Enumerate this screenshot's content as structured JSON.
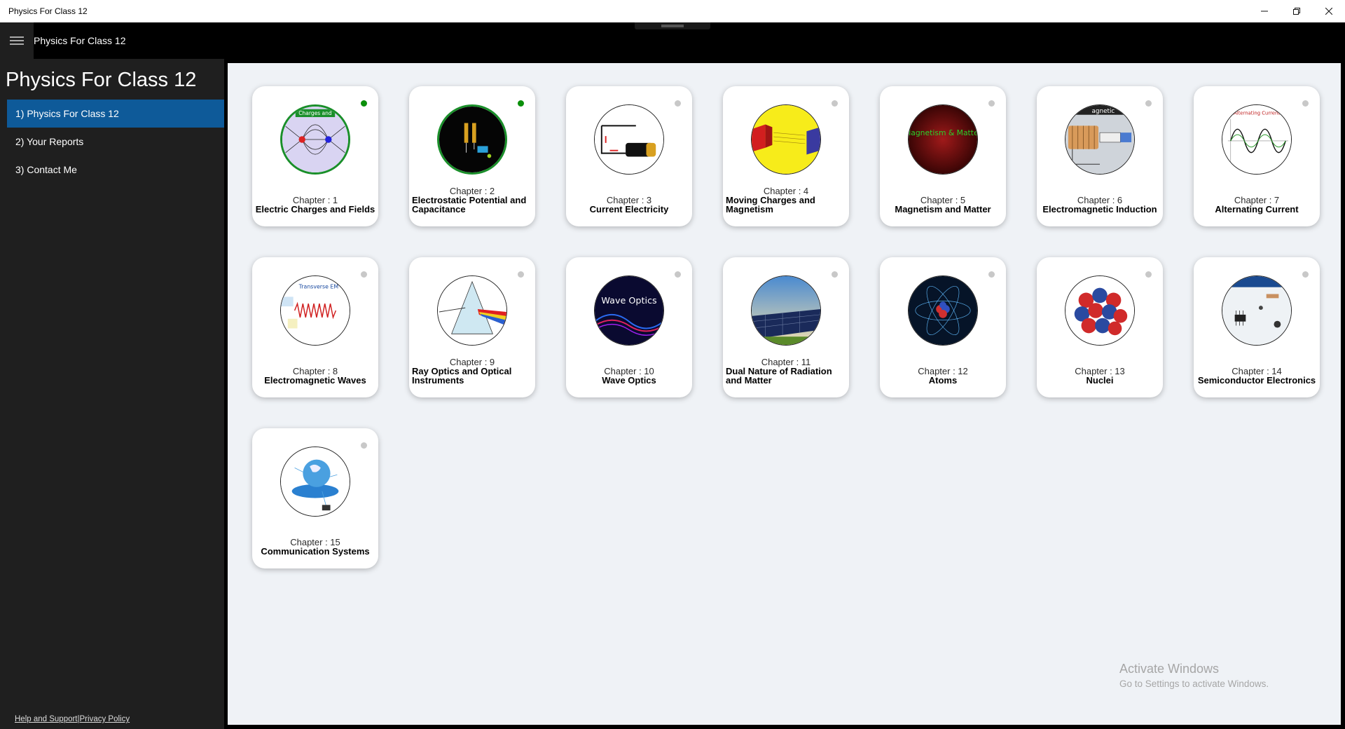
{
  "window": {
    "title": "Physics For Class 12",
    "minimize": "—",
    "restore": "❐",
    "close": "✕"
  },
  "appbar": {
    "title": "Physics For Class 12",
    "menu_icon": "hamburger-icon"
  },
  "sidebar": {
    "heading": "Physics For Class 12",
    "items": [
      {
        "label": "1) Physics For Class 12",
        "active": true
      },
      {
        "label": "2) Your Reports",
        "active": false
      },
      {
        "label": "3) Contact Me",
        "active": false
      }
    ],
    "footer": {
      "help": "Help and Support",
      "separator": "|",
      "privacy": "Privacy Policy"
    }
  },
  "colors": {
    "accent": "#0e5a99",
    "done_dot": "#0a8f0a",
    "pending_dot": "#c8c8c8"
  },
  "chapters": [
    {
      "chapter": "Chapter :  1",
      "name": "Electric Charges and Fields",
      "completed": true
    },
    {
      "chapter": "Chapter :  2",
      "name": "Electrostatic Potential and Capacitance",
      "completed": true
    },
    {
      "chapter": "Chapter :  3",
      "name": "Current Electricity",
      "completed": false
    },
    {
      "chapter": "Chapter :  4",
      "name": "Moving Charges and Magnetism",
      "completed": false
    },
    {
      "chapter": "Chapter :  5",
      "name": "Magnetism and Matter",
      "completed": false
    },
    {
      "chapter": "Chapter :  6",
      "name": "Electromagnetic Induction",
      "completed": false
    },
    {
      "chapter": "Chapter :  7",
      "name": "Alternating Current",
      "completed": false
    },
    {
      "chapter": "Chapter :  8",
      "name": "Electromagnetic Waves",
      "completed": false
    },
    {
      "chapter": "Chapter :  9",
      "name": "Ray Optics and Optical Instruments",
      "completed": false
    },
    {
      "chapter": "Chapter :  10",
      "name": "Wave Optics",
      "completed": false
    },
    {
      "chapter": "Chapter :  11",
      "name": "Dual Nature of Radiation and Matter",
      "completed": false
    },
    {
      "chapter": "Chapter :  12",
      "name": "Atoms",
      "completed": false
    },
    {
      "chapter": "Chapter :  13",
      "name": "Nuclei",
      "completed": false
    },
    {
      "chapter": "Chapter :  14",
      "name": "Semiconductor Electronics",
      "completed": false
    },
    {
      "chapter": "Chapter :  15",
      "name": "Communication Systems",
      "completed": false
    }
  ],
  "thumb_text": {
    "ch1": "Charges and",
    "ch5": "Magnetism & Matter",
    "ch6": "agnetic",
    "ch7": "Alternating Current",
    "ch8": "Transverse EM",
    "ch10": "Wave Optics"
  },
  "watermark": {
    "line1": "Activate Windows",
    "line2": "Go to Settings to activate Windows."
  }
}
